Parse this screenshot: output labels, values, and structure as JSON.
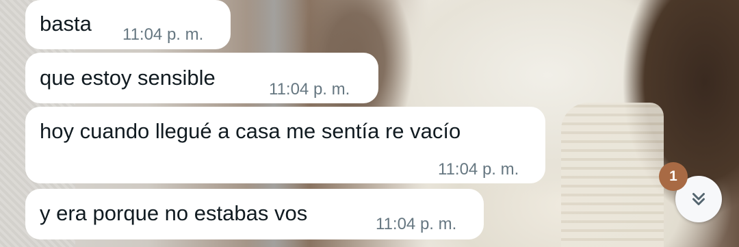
{
  "messages": [
    {
      "text": "basta",
      "time": "11:04 p. m."
    },
    {
      "text": "que estoy sensible",
      "time": "11:04 p. m."
    },
    {
      "text": "hoy cuando llegué a casa me sentía re vacío",
      "time": "11:04 p. m."
    },
    {
      "text": "y era porque no estabas vos",
      "time": "11:04 p. m."
    }
  ],
  "scroll_button": {
    "icon": "double-chevron-down-icon",
    "unread_count": "1"
  },
  "colors": {
    "bubble": "#ffffff",
    "message_text": "#111b21",
    "timestamp": "#667781",
    "badge": "#a86a44"
  }
}
